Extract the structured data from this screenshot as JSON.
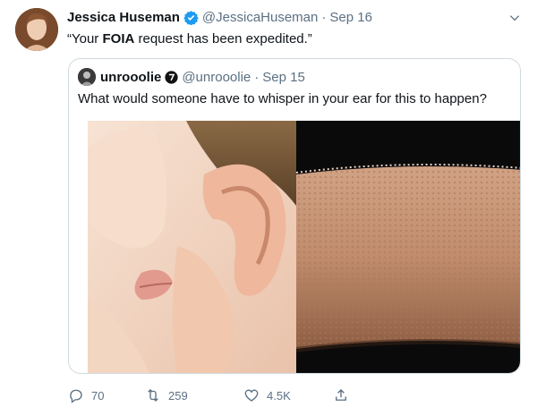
{
  "tweet": {
    "author_name": "Jessica Huseman",
    "handle": "@JessicaHuseman",
    "separator": "·",
    "date": "Sep 16",
    "text_prefix": "“Your ",
    "text_bold": "FOIA",
    "text_suffix": " request has been expedited.”"
  },
  "quoted": {
    "author_name": "unrooolie",
    "handle": "@unrooolie",
    "separator": "·",
    "date": "Sep 15",
    "text": "What would someone have to whisper in your ear for this to happen?",
    "media_left": "photo of a person whispering into someone's ear",
    "media_right": "photo of an arm with goosebumps"
  },
  "actions": {
    "reply_count": "70",
    "retweet_count": "259",
    "like_count": "4.5K"
  },
  "colors": {
    "verified": "#1d9bf0",
    "muted": "#5b7083",
    "border": "#cfd9de"
  },
  "icons": [
    "verified-badge-icon",
    "chevron-down-icon",
    "reply-icon",
    "retweet-icon",
    "like-icon",
    "share-icon"
  ]
}
